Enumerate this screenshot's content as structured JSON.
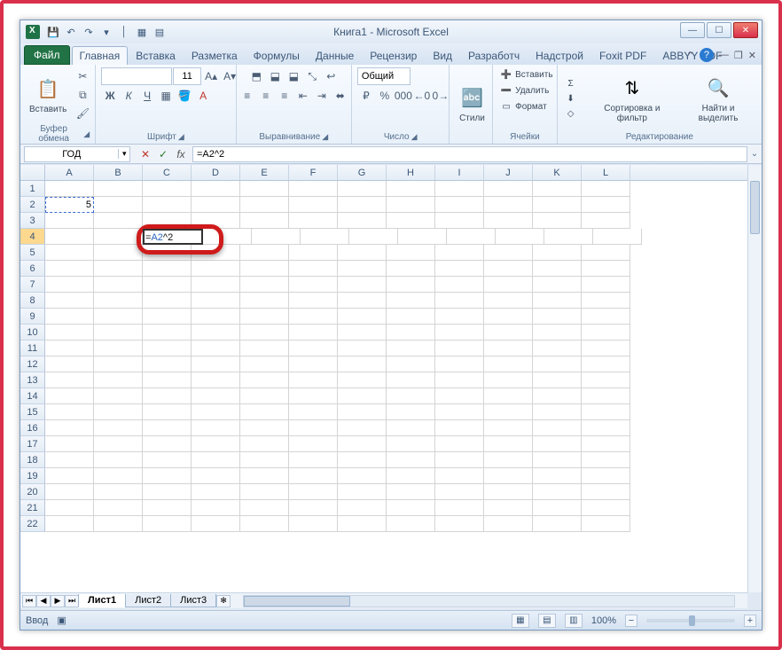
{
  "title": "Книга1 - Microsoft Excel",
  "qat": {
    "save": "save",
    "undo": "undo",
    "redo": "redo"
  },
  "tabs": {
    "file": "Файл",
    "items": [
      "Главная",
      "Вставка",
      "Разметка",
      "Формулы",
      "Данные",
      "Рецензир",
      "Вид",
      "Разработч",
      "Надстрой",
      "Foxit PDF",
      "ABBYY PDF"
    ],
    "activeIndex": 0
  },
  "ribbon": {
    "clipboard": {
      "paste": "Вставить",
      "group": "Буфер обмена"
    },
    "font": {
      "size": "11",
      "group": "Шрифт"
    },
    "alignment": {
      "group": "Выравнивание"
    },
    "number": {
      "format": "Общий",
      "group": "Число"
    },
    "styles": {
      "btn": "Стили",
      "group": ""
    },
    "cells": {
      "insert": "Вставить",
      "delete": "Удалить",
      "format": "Формат",
      "group": "Ячейки"
    },
    "editing": {
      "sigma": "Σ",
      "sort": "Сортировка и фильтр",
      "find": "Найти и выделить",
      "group": "Редактирование"
    }
  },
  "formulaBar": {
    "nameBox": "ГОД",
    "formula": "=A2^2"
  },
  "columns": [
    "A",
    "B",
    "C",
    "D",
    "E",
    "F",
    "G",
    "H",
    "I",
    "J",
    "K",
    "L"
  ],
  "rowCount": 22,
  "activeRow": 4,
  "cells": {
    "A2": "5",
    "C4": {
      "display": "=",
      "ref": "A2",
      "rest": "^2"
    }
  },
  "sheets": {
    "active": "Лист1",
    "items": [
      "Лист1",
      "Лист2",
      "Лист3"
    ]
  },
  "status": {
    "mode": "Ввод",
    "zoom": "100%"
  }
}
